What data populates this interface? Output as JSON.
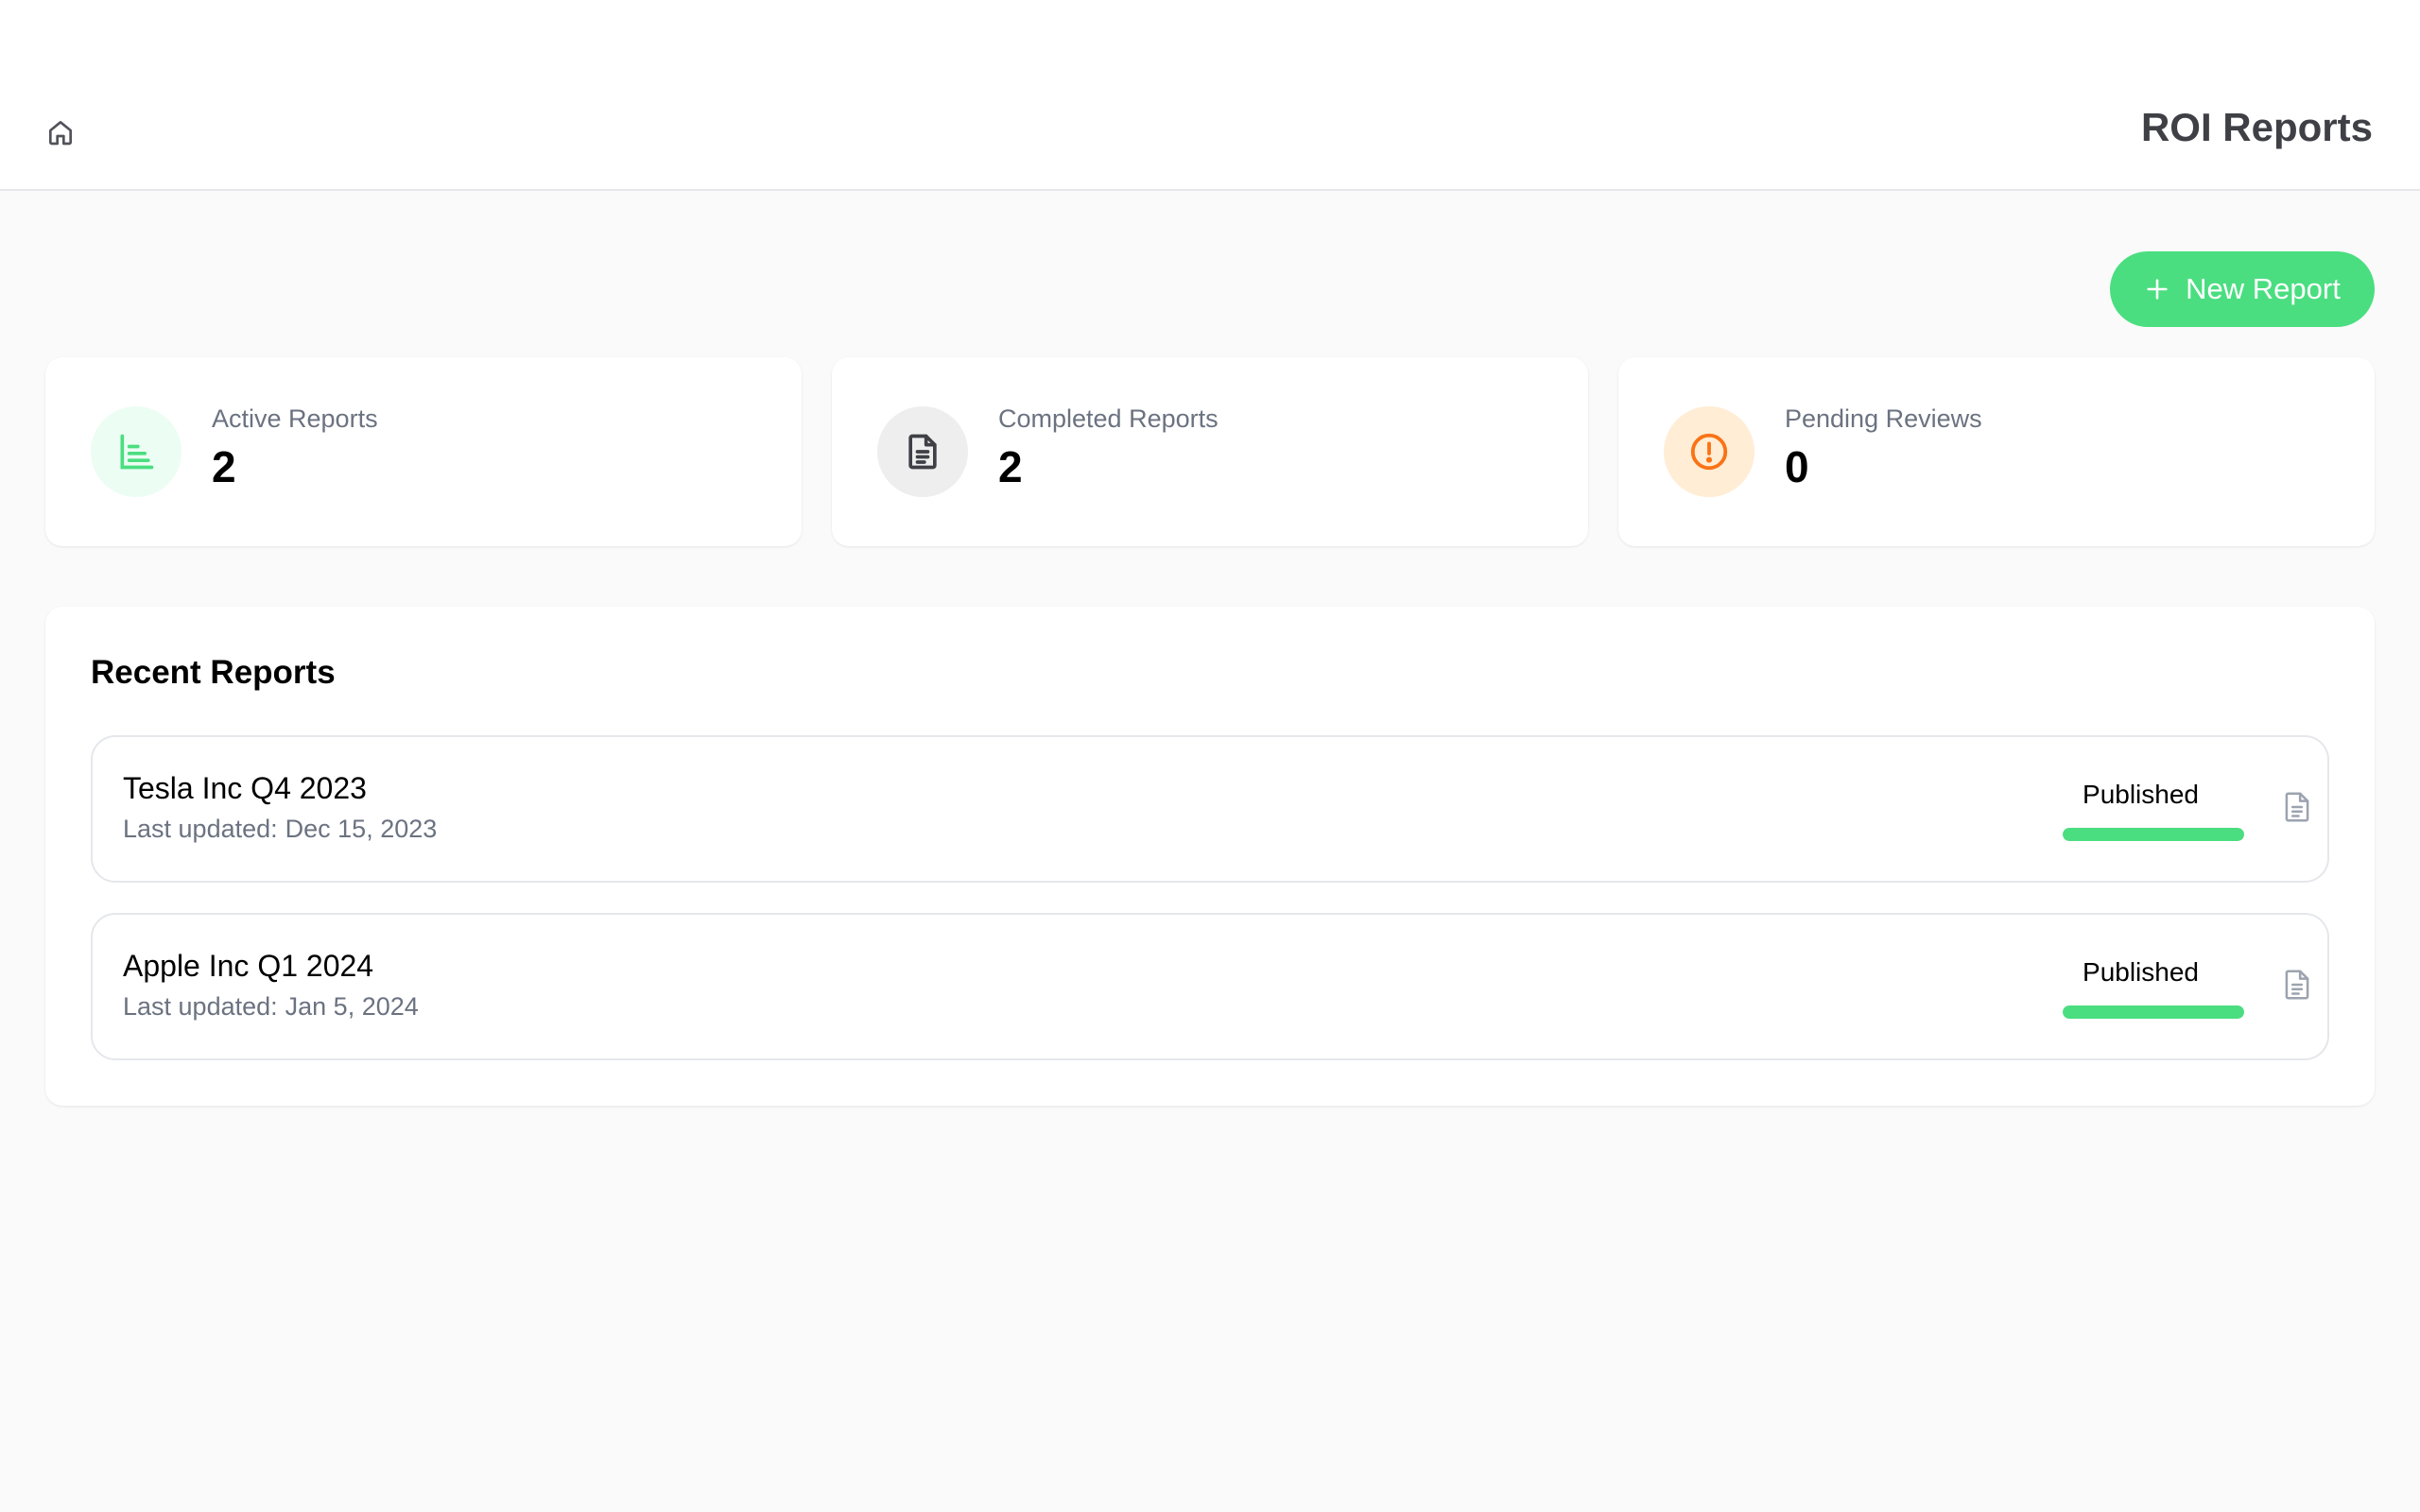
{
  "header": {
    "title": "ROI Reports",
    "home_icon": "home-icon"
  },
  "actions": {
    "new_report_label": "New Report",
    "new_report_icon": "plus-icon"
  },
  "stats": [
    {
      "label": "Active Reports",
      "value": "2",
      "icon": "bar-chart-icon",
      "icon_color": "#4ade80",
      "icon_bg": "#ecfdf3"
    },
    {
      "label": "Completed Reports",
      "value": "2",
      "icon": "document-icon",
      "icon_color": "#3f3f46",
      "icon_bg": "#eeeeee"
    },
    {
      "label": "Pending Reviews",
      "value": "0",
      "icon": "alert-circle-icon",
      "icon_color": "#f97316",
      "icon_bg": "#ffedd5"
    }
  ],
  "recent": {
    "title": "Recent Reports",
    "updated_prefix": "Last updated:",
    "items": [
      {
        "name": "Tesla Inc Q4 2023",
        "updated": "Dec 15, 2023",
        "status": "Published",
        "progress": 1.0
      },
      {
        "name": "Apple Inc Q1 2024",
        "updated": "Jan 5, 2024",
        "status": "Published",
        "progress": 1.0
      }
    ]
  },
  "colors": {
    "accent": "#4ade80",
    "background": "#fafafa",
    "muted_text": "#6b7280"
  }
}
